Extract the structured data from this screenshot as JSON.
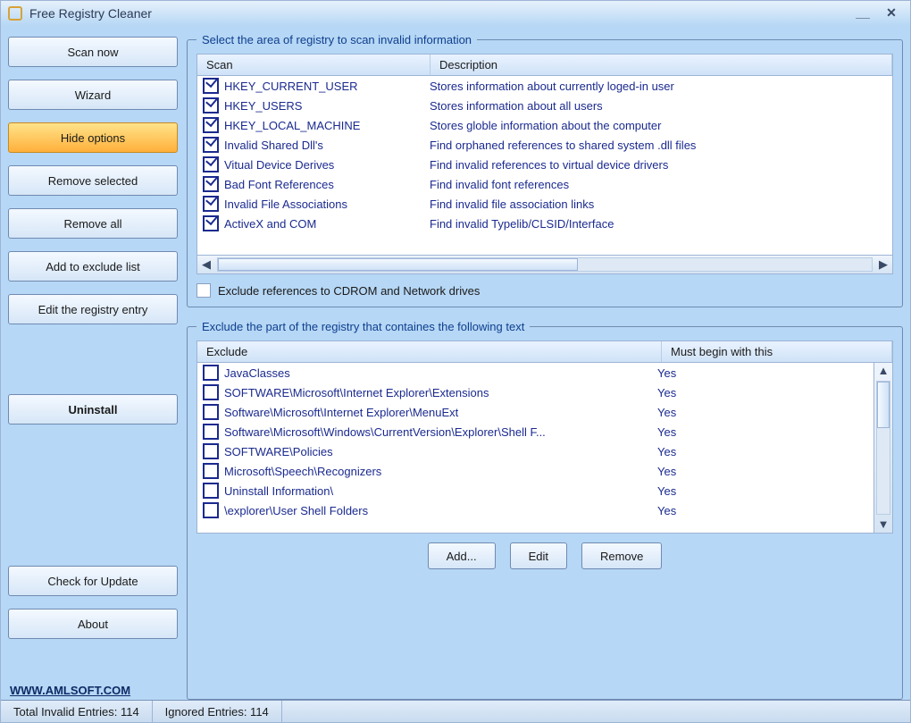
{
  "title": "Free Registry Cleaner",
  "sidebar": {
    "scan_now": "Scan now",
    "wizard": "Wizard",
    "hide_options": "Hide options",
    "remove_selected": "Remove selected",
    "remove_all": "Remove all",
    "add_exclude": "Add to exclude list",
    "edit_entry": "Edit the registry entry",
    "uninstall": "Uninstall",
    "check_update": "Check for Update",
    "about": "About"
  },
  "group1": {
    "legend": "Select the area of registry to scan invalid information",
    "col_scan": "Scan",
    "col_desc": "Description",
    "rows": [
      {
        "name": "HKEY_CURRENT_USER",
        "desc": "Stores information about currently loged-in user",
        "checked": true
      },
      {
        "name": "HKEY_USERS",
        "desc": "Stores information about all users",
        "checked": true
      },
      {
        "name": "HKEY_LOCAL_MACHINE",
        "desc": "Stores globle information about the computer",
        "checked": true
      },
      {
        "name": "Invalid Shared Dll's",
        "desc": "Find orphaned references to shared system .dll files",
        "checked": true
      },
      {
        "name": "Vitual Device Derives",
        "desc": "Find invalid references to virtual device drivers",
        "checked": true
      },
      {
        "name": "Bad Font References",
        "desc": "Find invalid font references",
        "checked": true
      },
      {
        "name": "Invalid File Associations",
        "desc": "Find invalid file association links",
        "checked": true
      },
      {
        "name": "ActiveX and COM",
        "desc": "Find invalid Typelib/CLSID/Interface",
        "checked": true
      }
    ],
    "exclude_net": "Exclude references to CDROM and Network drives"
  },
  "group2": {
    "legend": "Exclude the part of the registry that containes the following text",
    "col_exclude": "Exclude",
    "col_begin": "Must begin with this",
    "rows": [
      {
        "text": "JavaClasses",
        "begin": "Yes"
      },
      {
        "text": "SOFTWARE\\Microsoft\\Internet Explorer\\Extensions",
        "begin": "Yes"
      },
      {
        "text": "Software\\Microsoft\\Internet Explorer\\MenuExt",
        "begin": "Yes"
      },
      {
        "text": "Software\\Microsoft\\Windows\\CurrentVersion\\Explorer\\Shell F...",
        "begin": "Yes"
      },
      {
        "text": "SOFTWARE\\Policies",
        "begin": "Yes"
      },
      {
        "text": "Microsoft\\Speech\\Recognizers",
        "begin": "Yes"
      },
      {
        "text": "Uninstall Information\\",
        "begin": "Yes"
      },
      {
        "text": "\\explorer\\User Shell Folders",
        "begin": "Yes"
      }
    ],
    "add": "Add...",
    "edit": "Edit",
    "remove": "Remove"
  },
  "footer_link": "WWW.AMLSOFT.COM",
  "status": {
    "invalid": "Total Invalid Entries: 114",
    "ignored": "Ignored Entries: 114"
  }
}
